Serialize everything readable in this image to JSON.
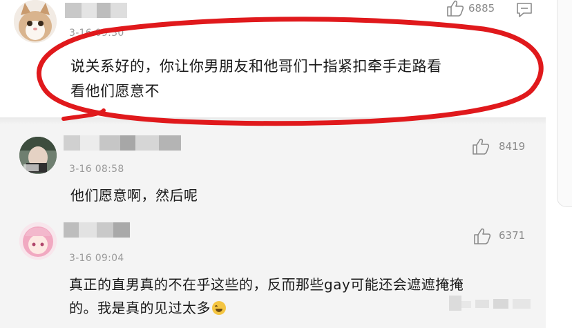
{
  "comments": [
    {
      "time": "3-16 09:30",
      "text_line1": "说关系好的，你让你男朋友和他哥们十指紧扣牵手走路看",
      "text_line2": "看他们愿意不",
      "likes": "6885",
      "comment_icon": "comment-icon"
    }
  ],
  "replies": [
    {
      "time": "3-16 08:58",
      "text_line1": "他们愿意啊，然后呢",
      "likes": "8419"
    },
    {
      "time": "3-16 09:04",
      "text_line1": "真正的直男真的不在乎这些的，反而那些gay可能还会遮遮掩掩",
      "text_line2": "的。我是真的见过太多",
      "likes": "6371"
    }
  ],
  "icons": {
    "like": "thumbs-up-icon",
    "comment": "comment-icon",
    "emoji": "laughing-crying-emoji-icon"
  },
  "colors": {
    "highlight_red": "#e0191c",
    "reply_background": "#f4f4f4",
    "time_gray": "#9a9a9a"
  }
}
